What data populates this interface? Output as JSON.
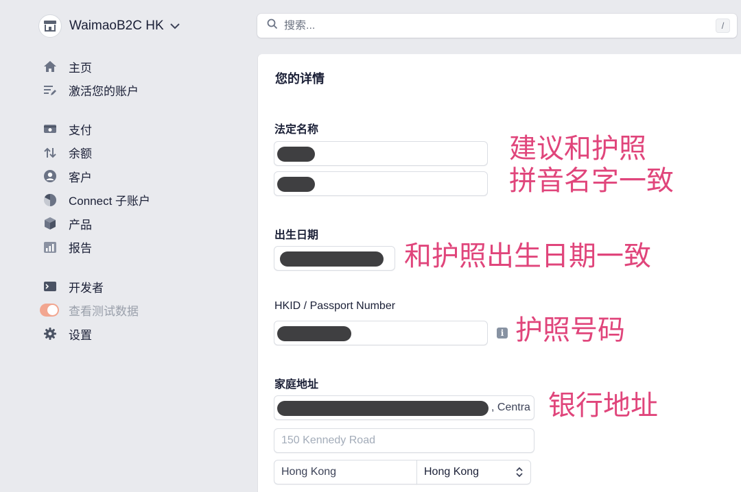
{
  "account": {
    "name": "WaimaoB2C HK"
  },
  "search": {
    "placeholder": "搜索...",
    "shortcut": "/"
  },
  "sidebar": {
    "groups": [
      [
        {
          "label": "主页",
          "icon": "home-icon"
        },
        {
          "label": "激活您的账户",
          "icon": "activate-account-icon"
        }
      ],
      [
        {
          "label": "支付",
          "icon": "payments-icon"
        },
        {
          "label": "余额",
          "icon": "balance-icon"
        },
        {
          "label": "客户",
          "icon": "customer-icon"
        },
        {
          "label": "Connect 子账户",
          "icon": "connect-icon"
        },
        {
          "label": "产品",
          "icon": "product-box-icon"
        },
        {
          "label": "报告",
          "icon": "report-chart-icon"
        }
      ],
      [
        {
          "label": "开发者",
          "icon": "terminal-icon"
        },
        {
          "label": "查看测试数据",
          "icon": "test-data-toggle",
          "toggle_on": true
        },
        {
          "label": "设置",
          "icon": "gear-icon"
        }
      ]
    ]
  },
  "form": {
    "section_title": "您的详情",
    "legal_name": {
      "label": "法定名称"
    },
    "dob": {
      "label": "出生日期"
    },
    "id_number": {
      "label": "HKID / Passport Number"
    },
    "address": {
      "label": "家庭地址",
      "line1_visible_suffix": ", Centra",
      "line2_placeholder": "150 Kennedy Road",
      "city": "Hong Kong",
      "region": "Hong Kong"
    }
  },
  "annotations": {
    "name_line1": "建议和护照",
    "name_line2": "拼音名字一致",
    "dob": "和护照出生日期一致",
    "passport": "护照号码",
    "address": "银行地址"
  },
  "colors": {
    "annotation": "#e0457b",
    "toggle": "#f2a690",
    "redaction": "#3f3f41"
  }
}
